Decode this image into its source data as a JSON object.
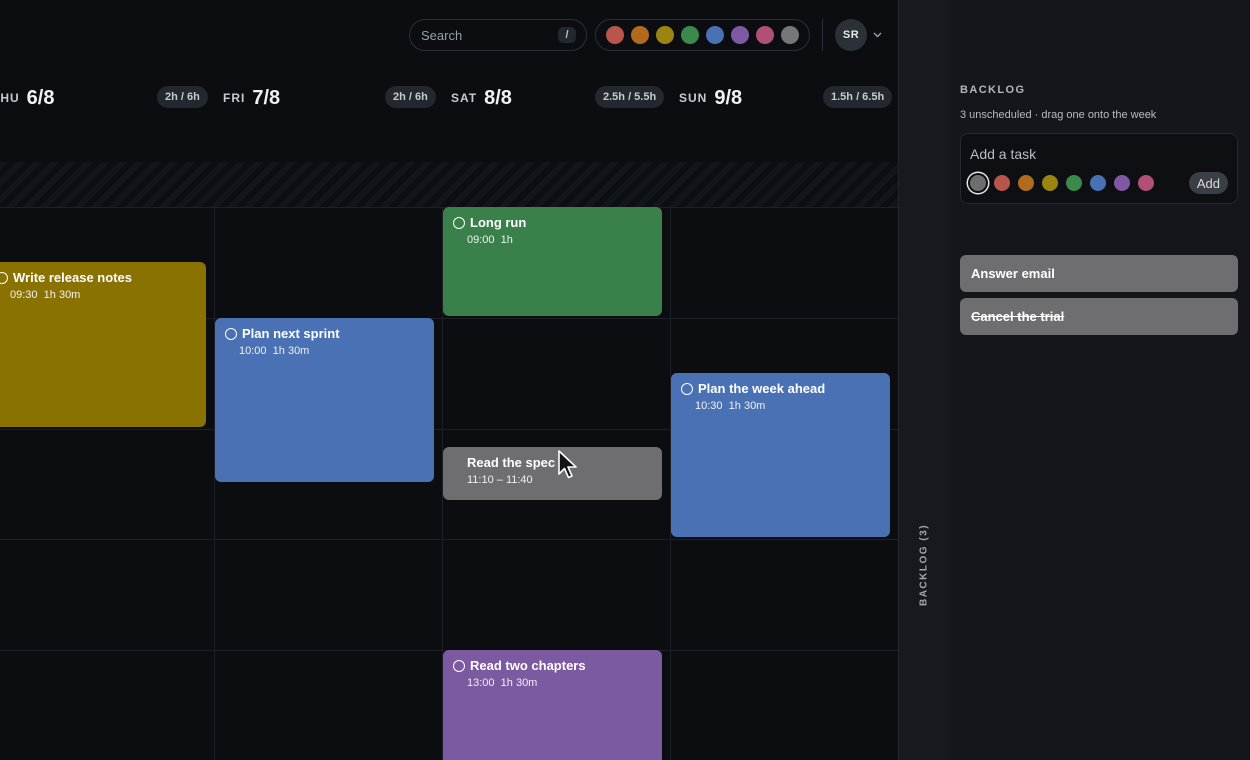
{
  "search": {
    "label": "Search",
    "shortcut": "/"
  },
  "color_filters": [
    {
      "name": "red",
      "hex": "#b9564c"
    },
    {
      "name": "orange",
      "hex": "#b26a1f"
    },
    {
      "name": "olive",
      "hex": "#9b8410"
    },
    {
      "name": "green",
      "hex": "#3b8a4d"
    },
    {
      "name": "blue",
      "hex": "#4a71b4"
    },
    {
      "name": "purple",
      "hex": "#7d5aa3"
    },
    {
      "name": "pink",
      "hex": "#b24f76"
    },
    {
      "name": "gray",
      "hex": "#76777a"
    }
  ],
  "user": {
    "initials": "SR"
  },
  "days": [
    {
      "dow": "THU",
      "date": "6/8",
      "hours": "2h / 6h"
    },
    {
      "dow": "FRI",
      "date": "7/8",
      "hours": "2h / 6h"
    },
    {
      "dow": "SAT",
      "date": "8/8",
      "hours": "2.5h / 5.5h"
    },
    {
      "dow": "SUN",
      "date": "9/8",
      "hours": "1.5h / 6.5h"
    }
  ],
  "events": [
    {
      "title": "Write release notes",
      "time": "09:30",
      "duration": "1h 30m",
      "color": "#8a7200"
    },
    {
      "title": "Plan next sprint",
      "time": "10:00",
      "duration": "1h 30m",
      "color": "#4a71b4"
    },
    {
      "title": "Long run",
      "time": "09:00",
      "duration": "1h",
      "color": "#39804a"
    },
    {
      "title": "Read the spec",
      "time": "11:10 – 11:40",
      "duration": "",
      "color": "#6e6e70"
    },
    {
      "title": "Read two chapters",
      "time": "13:00",
      "duration": "1h 30m",
      "color": "#7c5aa2"
    },
    {
      "title": "Plan the week ahead",
      "time": "10:30",
      "duration": "1h 30m",
      "color": "#4a71b4"
    }
  ],
  "rail": {
    "label": "BACKLOG (3)"
  },
  "backlog": {
    "title": "BACKLOG",
    "subtitle": "3 unscheduled · drag one onto the week",
    "add_placeholder": "Add a task",
    "add_button": "Add",
    "color_options": [
      {
        "name": "gray",
        "hex": "#6e6e70",
        "selected": true
      },
      {
        "name": "red",
        "hex": "#b9564c"
      },
      {
        "name": "orange",
        "hex": "#b26a1f"
      },
      {
        "name": "olive",
        "hex": "#9b8410"
      },
      {
        "name": "green",
        "hex": "#3b8a4d"
      },
      {
        "name": "blue",
        "hex": "#4a71b4"
      },
      {
        "name": "purple",
        "hex": "#7d5aa3"
      },
      {
        "name": "pink",
        "hex": "#b24f76"
      }
    ],
    "tasks": [
      {
        "title": "Answer email",
        "done": false
      },
      {
        "title": "Cancel the trial",
        "done": true
      }
    ]
  }
}
